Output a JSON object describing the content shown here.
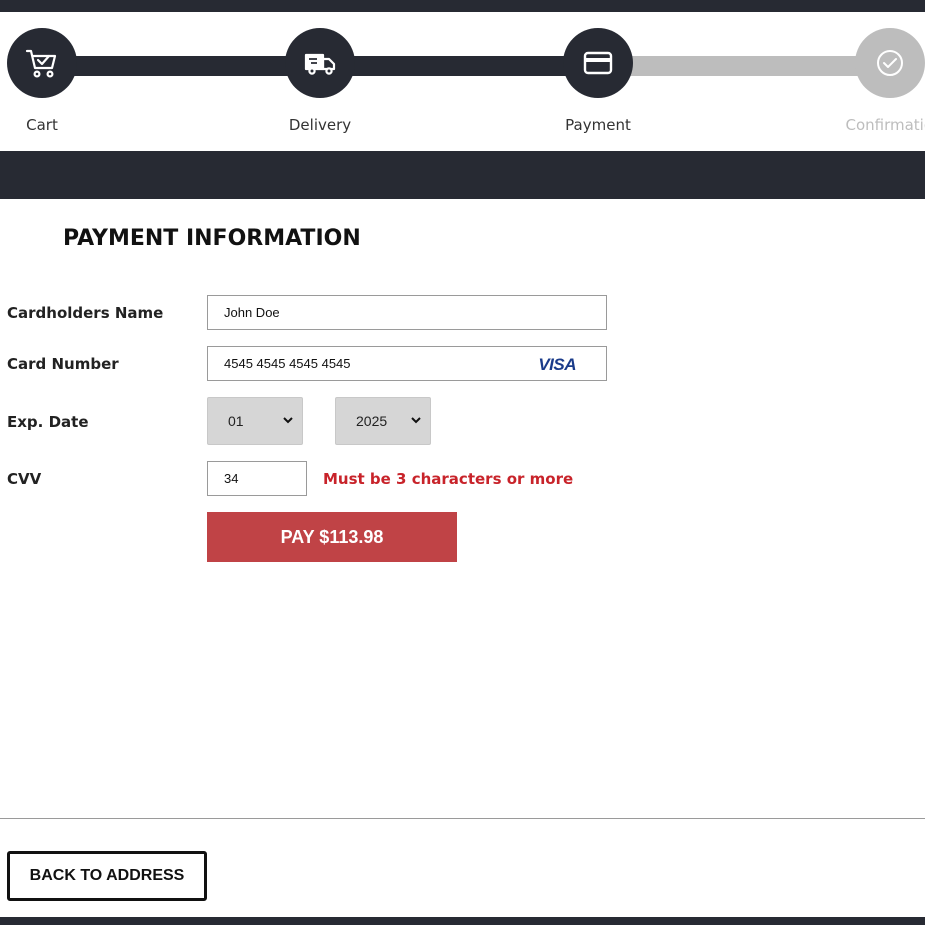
{
  "stepper": {
    "steps": [
      {
        "label": "Cart",
        "icon": "cart-check-icon",
        "state": "done"
      },
      {
        "label": "Delivery",
        "icon": "truck-icon",
        "state": "done"
      },
      {
        "label": "Payment",
        "icon": "credit-card-icon",
        "state": "done"
      },
      {
        "label": "Confirmation",
        "icon": "check-circle-icon",
        "state": "todo"
      }
    ],
    "colors": {
      "done": "#272a33",
      "todo": "#bdbdbd"
    }
  },
  "payment": {
    "title": "PAYMENT INFORMATION",
    "cardholder": {
      "label": "Cardholders Name",
      "value": "John Doe"
    },
    "card_number": {
      "label": "Card Number",
      "value": "4545 4545 4545 4545",
      "brand": "VISA"
    },
    "exp_date": {
      "label": "Exp. Date",
      "month": "01",
      "year": "2025"
    },
    "cvv": {
      "label": "CVV",
      "value": "34",
      "error": "Must be 3 characters or more"
    },
    "pay_button": "PAY $113.98"
  },
  "footer": {
    "back_button": "BACK TO ADDRESS"
  },
  "colors": {
    "dark": "#272a33",
    "accent": "#c04346",
    "error": "#c8232a"
  }
}
